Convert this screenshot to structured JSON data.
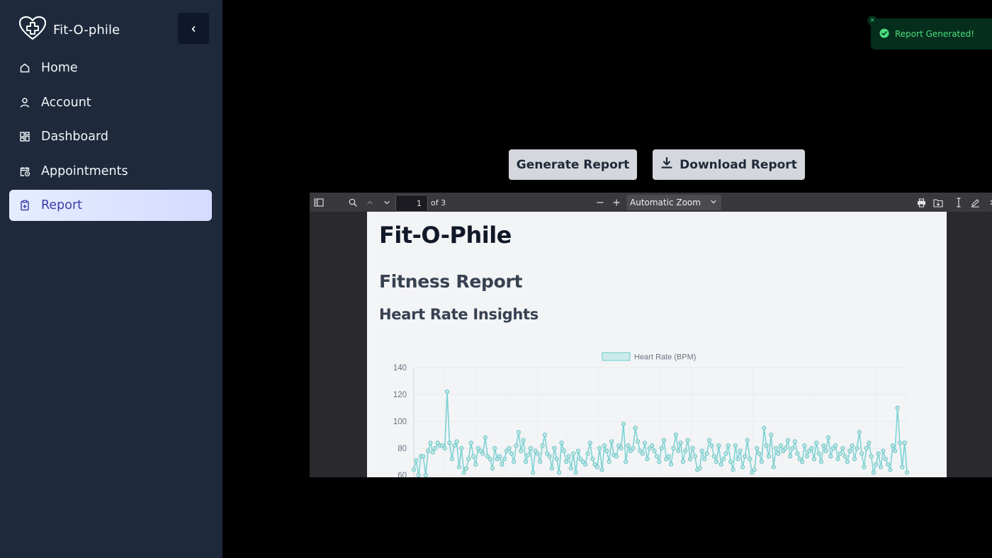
{
  "brand": {
    "name": "Fit-O-phile"
  },
  "sidebar": {
    "items": [
      {
        "label": "Home",
        "icon": "home-icon"
      },
      {
        "label": "Account",
        "icon": "user-icon"
      },
      {
        "label": "Dashboard",
        "icon": "dashboard-icon"
      },
      {
        "label": "Appointments",
        "icon": "calendar-clock-icon"
      },
      {
        "label": "Report",
        "icon": "clipboard-plus-icon",
        "active": true
      }
    ]
  },
  "actions": {
    "generate_label": "Generate Report",
    "download_label": "Download Report"
  },
  "toast": {
    "message": "Report Generated!",
    "close": "×"
  },
  "viewer": {
    "page_number": "1",
    "page_total": "of 3",
    "zoom": "Automatic Zoom"
  },
  "document": {
    "title": "Fit-O-Phile",
    "subtitle": "Fitness Report",
    "section": "Heart Rate Insights"
  },
  "colors": {
    "sidebar_bg": "#1e293b",
    "active_text": "#3b3fa8",
    "chart_line": "#7dd3d3",
    "toast_text": "#4ade80"
  },
  "chart_data": {
    "type": "line",
    "legend": "Heart Rate (BPM)",
    "ylim": [
      60,
      140
    ],
    "yticks": [
      "140",
      "120",
      "100",
      "80",
      "60"
    ],
    "series": [
      {
        "name": "Heart Rate (BPM)",
        "values": [
          64,
          71,
          60,
          74,
          74,
          60,
          78,
          84,
          77,
          80,
          84,
          82,
          82,
          80,
          122,
          84,
          72,
          82,
          85,
          66,
          80,
          62,
          65,
          72,
          84,
          74,
          68,
          80,
          78,
          76,
          88,
          74,
          72,
          65,
          80,
          72,
          74,
          68,
          72,
          78,
          80,
          76,
          70,
          82,
          92,
          78,
          86,
          70,
          75,
          80,
          62,
          78,
          76,
          70,
          82,
          90,
          76,
          74,
          65,
          80,
          72,
          62,
          84,
          78,
          70,
          74,
          65,
          76,
          62,
          78,
          72,
          70,
          68,
          76,
          84,
          72,
          68,
          66,
          80,
          64,
          82,
          78,
          70,
          85,
          75,
          74,
          82,
          80,
          98,
          70,
          82,
          78,
          80,
          95,
          85,
          78,
          76,
          84,
          72,
          80,
          82,
          78,
          74,
          70,
          80,
          86,
          72,
          74,
          68,
          80,
          90,
          78,
          84,
          70,
          78,
          86,
          72,
          80,
          74,
          64,
          65,
          78,
          72,
          76,
          86,
          82,
          74,
          70,
          82,
          68,
          72,
          76,
          82,
          70,
          64,
          82,
          72,
          78,
          66,
          74,
          86,
          72,
          62,
          64,
          80,
          76,
          70,
          95,
          82,
          74,
          90,
          66,
          80,
          76,
          82,
          78,
          80,
          86,
          74,
          80,
          85,
          76,
          72,
          70,
          82,
          74,
          78,
          80,
          72,
          84,
          76,
          70,
          82,
          78,
          88,
          74,
          80,
          82,
          72,
          76,
          80,
          74,
          70,
          78,
          82,
          72,
          80,
          92,
          76,
          66,
          80,
          84,
          74,
          62,
          68,
          76,
          66,
          78,
          72,
          68,
          64,
          82,
          78,
          110,
          84,
          66,
          84,
          62
        ]
      }
    ]
  }
}
